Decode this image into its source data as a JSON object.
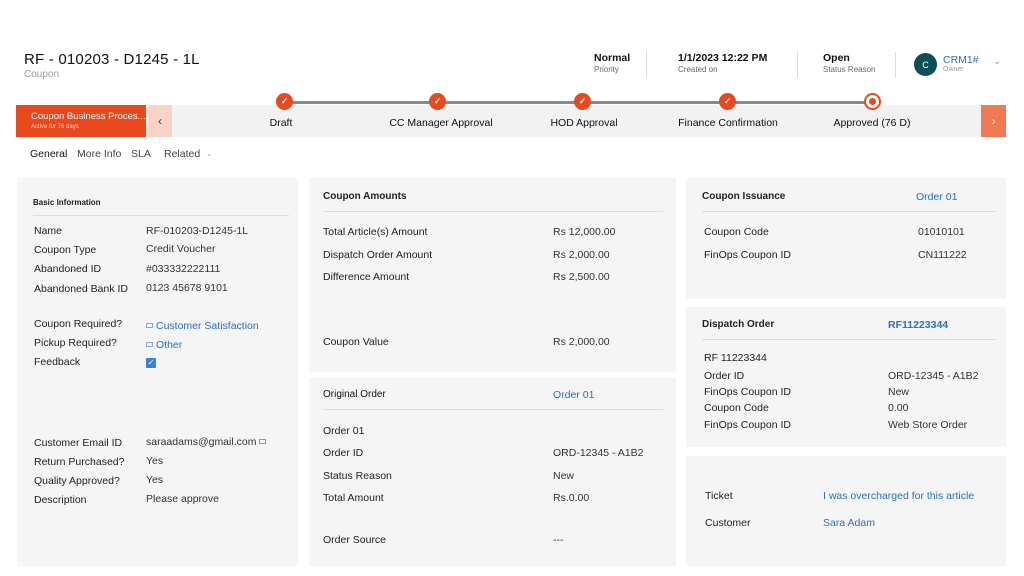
{
  "header": {
    "title": "RF - 010203 - D1245 - 1L",
    "entity": "Coupon",
    "fields": [
      {
        "value": "Normal",
        "label": "Priority"
      },
      {
        "value": "1/1/2023 12:22 PM",
        "label": "Created on"
      },
      {
        "value": "Open",
        "label": "Status Reason"
      }
    ],
    "owner": {
      "initial": "C",
      "name": "CRM1#",
      "label": "Owner"
    }
  },
  "process": {
    "active_name": "Coupon Business Proces...",
    "active_sub": "Active for 76 days",
    "prev_icon": "‹",
    "next_icon": "›",
    "stages": [
      {
        "label": "Draft",
        "state": "done"
      },
      {
        "label": "CC Manager Approval",
        "state": "done"
      },
      {
        "label": "HOD Approval",
        "state": "done"
      },
      {
        "label": "Finance Confirmation",
        "state": "done"
      },
      {
        "label": "Approved (76 D)",
        "state": "current"
      }
    ]
  },
  "tabs": [
    "General",
    "More Info",
    "SLA",
    "Related"
  ],
  "basic": {
    "title": "Basic Information",
    "rows": [
      {
        "label": "Name",
        "value": "RF-010203-D1245-1L"
      },
      {
        "label": "Coupon Type",
        "value": "Credit Voucher"
      },
      {
        "label": "Abandoned ID",
        "value": "#033332222111"
      },
      {
        "label": "Abandoned Bank ID",
        "value": "0123 45678 9101"
      }
    ],
    "rows2": [
      {
        "label": "Coupon Required?",
        "value": "Customer Satisfaction"
      },
      {
        "label": "Pickup Required?",
        "value": "Other"
      },
      {
        "label": "Feedback",
        "value": ""
      }
    ],
    "rows3": [
      {
        "label": "Customer Email ID",
        "value": "saraadams@gmail.com"
      },
      {
        "label": "Return Purchased?",
        "value": "Yes"
      },
      {
        "label": "Quality Approved?",
        "value": "Yes"
      },
      {
        "label": "Description",
        "value": "Please approve"
      }
    ]
  },
  "amounts": {
    "title": "Coupon Amounts",
    "rows": [
      {
        "label": "Total Article(s) Amount",
        "value": "Rs 12,000.00"
      },
      {
        "label": "Dispatch Order Amount",
        "value": "Rs 2,000.00"
      },
      {
        "label": "Difference Amount",
        "value": "Rs 2,500.00"
      }
    ],
    "coupon_value": {
      "label": "Coupon Value",
      "value": "Rs 2,000.00"
    }
  },
  "original": {
    "title": "Original Order",
    "link": "Order 01",
    "rows": [
      {
        "label": "Order 01",
        "value": ""
      },
      {
        "label": "Order ID",
        "value": "ORD-12345 - A1B2"
      },
      {
        "label": "Status Reason",
        "value": "New"
      },
      {
        "label": "Total Amount",
        "value": "Rs.0.00"
      }
    ],
    "source": {
      "label": "Order Source",
      "value": "---"
    }
  },
  "issuance": {
    "title": "Coupon Issuance",
    "link": "Order 01",
    "rows": [
      {
        "label": "Coupon Code",
        "value": "01010101"
      },
      {
        "label": "FinOps Coupon ID",
        "value": "CN111222"
      }
    ]
  },
  "dispatch": {
    "title": "Dispatch Order",
    "link": "RF11223344",
    "first": "RF 11223344",
    "rows": [
      {
        "label": "Order ID",
        "value": "ORD-12345 - A1B2"
      },
      {
        "label": "FinOps Coupon ID",
        "value": "New"
      },
      {
        "label": "Coupon Code",
        "value": "0.00"
      },
      {
        "label": "FinOps Coupon ID",
        "value": "Web Store Order"
      }
    ]
  },
  "ticket": {
    "rows": [
      {
        "label": "Ticket",
        "value": "I was overcharged for this article"
      },
      {
        "label": "Customer",
        "value": "Sara Adam"
      }
    ]
  }
}
